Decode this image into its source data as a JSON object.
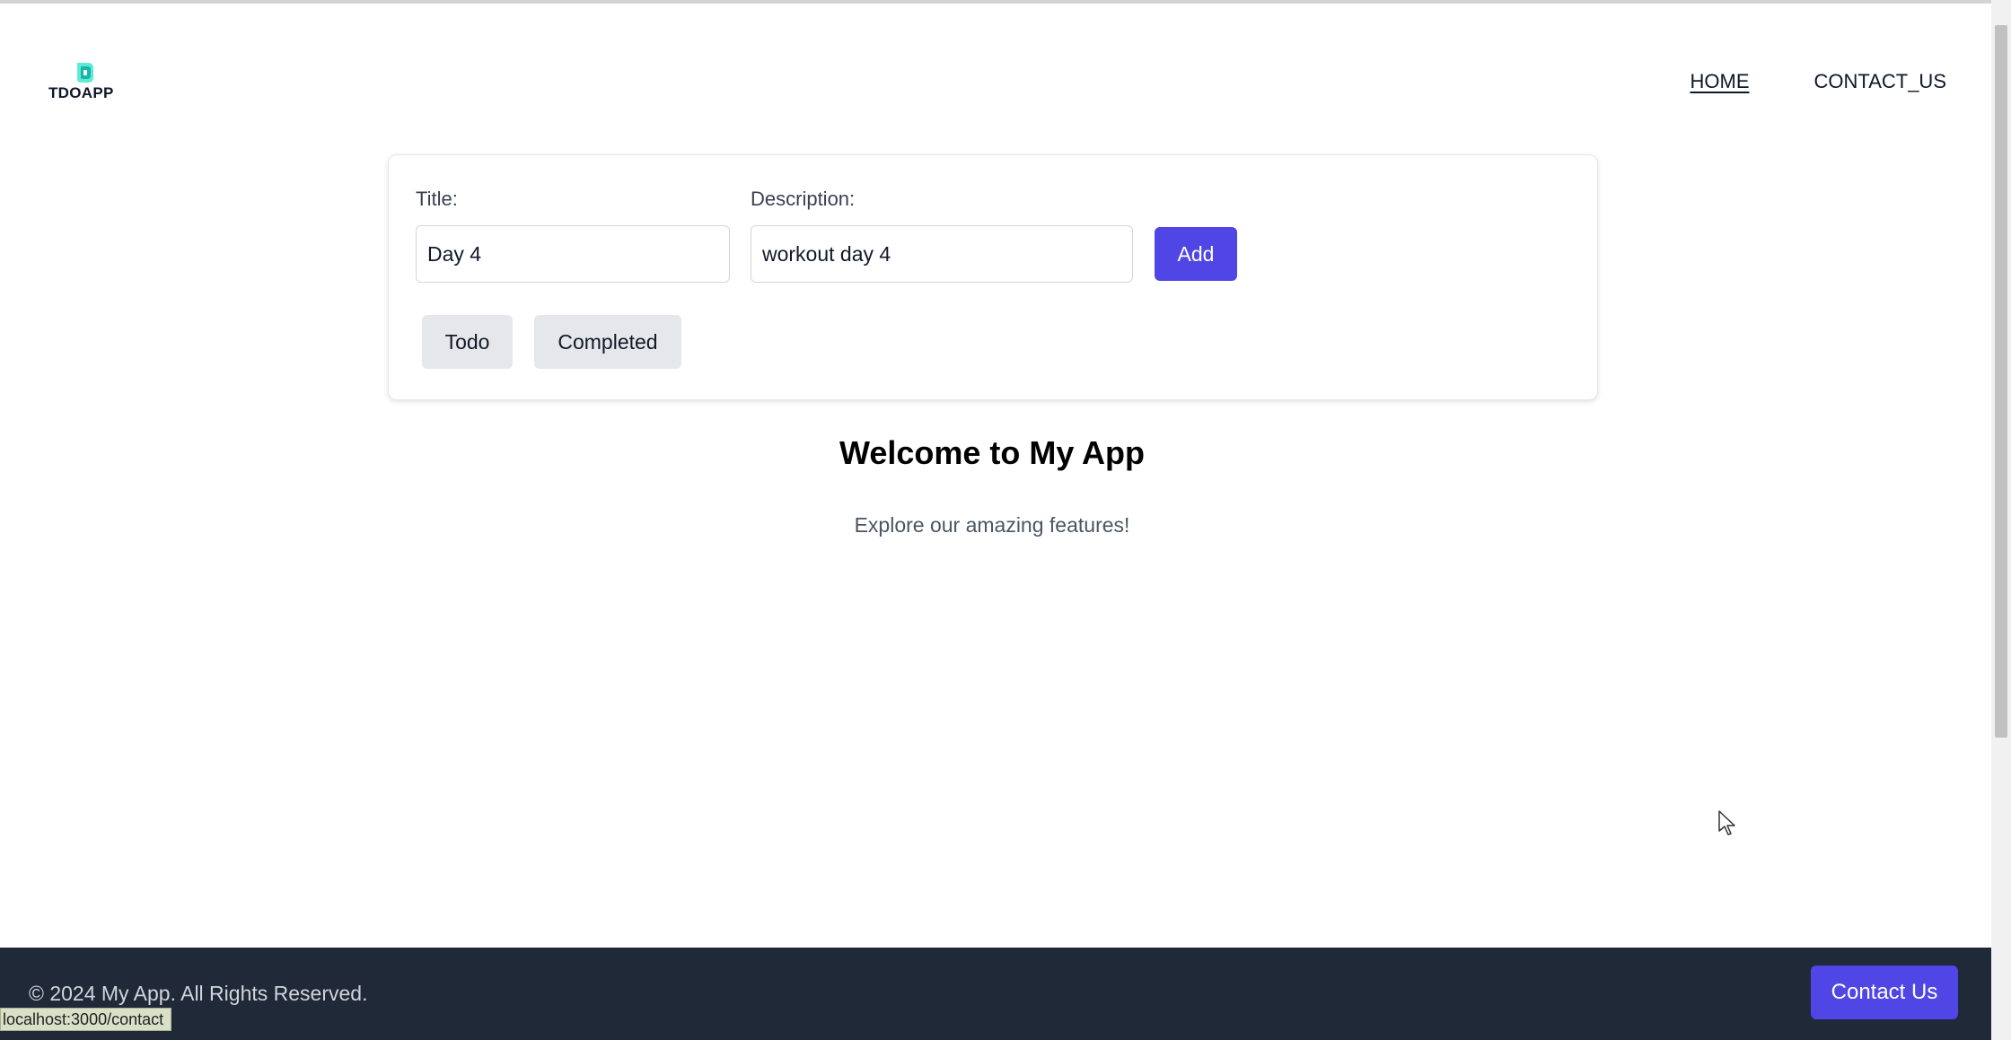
{
  "header": {
    "logo_text": "TDOAPP",
    "nav": [
      {
        "label": "HOME",
        "active": true
      },
      {
        "label": "CONTACT_US",
        "active": false
      }
    ]
  },
  "form": {
    "title_label": "Title:",
    "title_value": "Day 4",
    "description_label": "Description:",
    "description_value": "workout day 4",
    "add_label": "Add",
    "filters": [
      "Todo",
      "Completed"
    ]
  },
  "main": {
    "heading": "Welcome to My App",
    "tagline": "Explore our amazing features!"
  },
  "footer": {
    "copyright": "© 2024 My App. All Rights Reserved.",
    "contact_label": "Contact Us"
  },
  "status_bar": {
    "url": "localhost:3000/contact"
  },
  "colors": {
    "accent": "#4f46e5",
    "footer_bg": "#1f2937",
    "filter_bg": "#e5e7eb",
    "logo_teal": "#2dd4bf"
  }
}
